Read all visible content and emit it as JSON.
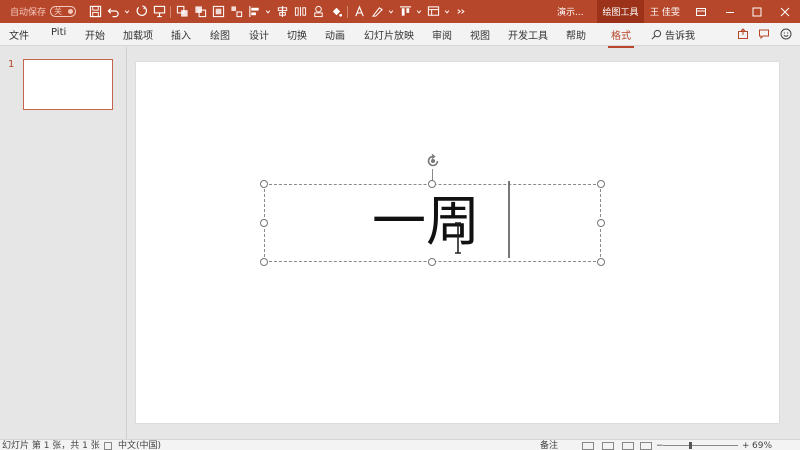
{
  "titlebar": {
    "autosave_label": "自动保存",
    "autosave_state": "关",
    "doc_title": "演示...",
    "context_tab": "绘图工具",
    "user": "王 佳雯",
    "qat_icons": [
      "save-icon",
      "undo-icon",
      "redo-icon",
      "present-icon",
      "bring-forward-icon",
      "send-backward-icon",
      "group-icon",
      "ungroup-icon",
      "align-left-icon",
      "align-center-icon",
      "distribute-icon",
      "shapes-icon",
      "fill-icon",
      "text-direction-icon",
      "format-icon",
      "align-top-icon",
      "layout-icon",
      "more-icon"
    ],
    "window_buttons": [
      "ribbon-display-icon",
      "minimize-icon",
      "maximize-icon",
      "close-icon"
    ],
    "brand_color": "#b7472a"
  },
  "ribbon": {
    "tabs": [
      "文件",
      "Piti",
      "开始",
      "加载项",
      "插入",
      "绘图",
      "设计",
      "切换",
      "动画",
      "幻灯片放映",
      "审阅",
      "视图",
      "开发工具",
      "帮助",
      "格式"
    ],
    "active_tab": "格式",
    "tell_me": "告诉我",
    "right_icons": [
      "share-icon",
      "comment-icon",
      "smiley-icon"
    ]
  },
  "thumbnails": {
    "items": [
      {
        "number": "1"
      }
    ]
  },
  "slide": {
    "text": "一周"
  },
  "statusbar": {
    "slide_info": "幻灯片 第 1 张，共 1 张",
    "language": "中文(中国)",
    "notes": "备注",
    "zoom": "69%",
    "zoom_level": 0.69
  }
}
